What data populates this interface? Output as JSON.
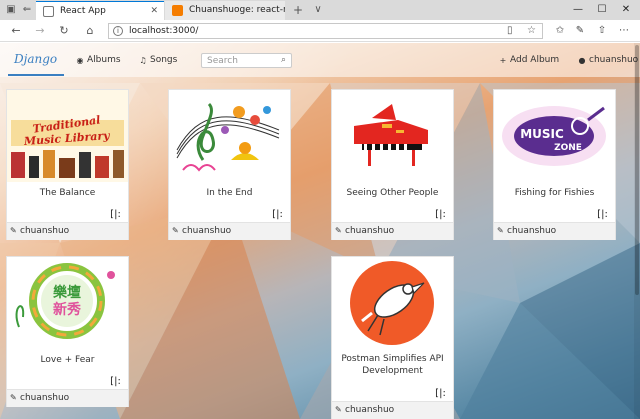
{
  "browser": {
    "tabs": [
      {
        "title": "React App",
        "favicon_color": "#5b9bd5"
      },
      {
        "title": "Chuanshuoge: react-redux",
        "favicon_color": "#f57d00"
      }
    ],
    "new_tab": "+",
    "tab_menu": "∨",
    "window_controls": {
      "minimize": "—",
      "maximize": "☐",
      "close": "✕"
    },
    "url": "localhost:3000/"
  },
  "app": {
    "brand": "Django",
    "nav": {
      "albums": "Albums",
      "songs": "Songs",
      "add_album": "Add Album",
      "user": "chuanshuo"
    },
    "search_placeholder": "Search",
    "accent_color": "#3a7fc1"
  },
  "albums": [
    {
      "title": "The Balance",
      "owner": "chuanshuo",
      "art_text": "Traditional Music Library"
    },
    {
      "title": "In the End",
      "owner": "chuanshuo",
      "art_text": ""
    },
    {
      "title": "Seeing Other People",
      "owner": "chuanshuo",
      "art_text": ""
    },
    {
      "title": "Fishing for Fishies",
      "owner": "chuanshuo",
      "art_text": "MUSIC ZONE"
    },
    {
      "title": "Love + Fear",
      "owner": "chuanshuo",
      "art_text": "樂壇新秀"
    },
    {
      "title": "Postman Simplifies API Development",
      "owner": "chuanshuo",
      "art_text": ""
    }
  ]
}
